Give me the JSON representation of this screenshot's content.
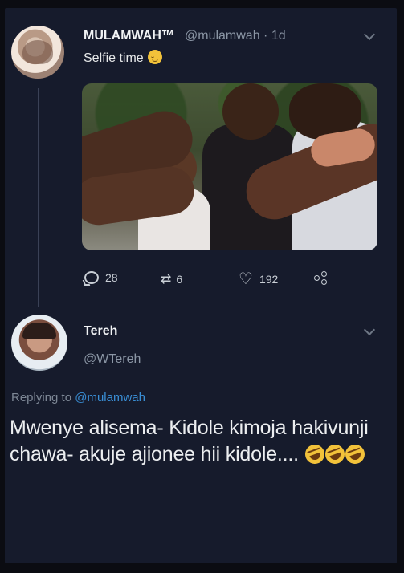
{
  "tweet1": {
    "display_name": "MULAMWAH™",
    "handle_time": "@mulamwah · 1d",
    "text": "Selfie time",
    "emoji_icon": "relieved-face-icon",
    "stats": {
      "replies": "28",
      "retweets": "6",
      "likes": "192"
    }
  },
  "tweet2": {
    "display_name": "Tereh",
    "handle": "@WTereh",
    "replying_prefix": "Replying to",
    "replying_mention": "@mulamwah",
    "body": "Mwenye alisema- Kidole kimoja hakivunji chawa- akuje ajionee hii kidole....",
    "emoji_icon": "rolling-on-floor-laughing-icon",
    "emoji_count": 3
  },
  "colors": {
    "background": "#161b2c",
    "mention": "#3a8fd6",
    "secondary_text": "#8b96a5"
  }
}
